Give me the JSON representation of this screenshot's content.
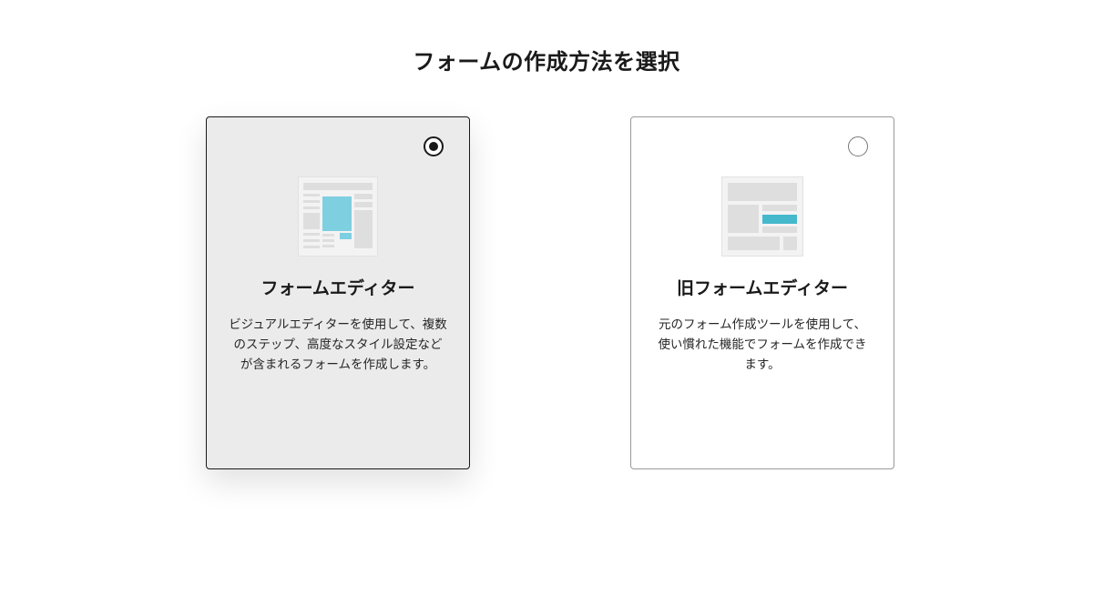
{
  "header": {
    "title": "フォームの作成方法を選択"
  },
  "options": [
    {
      "title": "フォームエディター",
      "description": "ビジュアルエディターを使用して、複数のステップ、高度なスタイル設定などが含まれるフォームを作成します。",
      "selected": true,
      "accent_color": "#7ecfe0"
    },
    {
      "title": "旧フォームエディター",
      "description": "元のフォーム作成ツールを使用して、使い慣れた機能でフォームを作成できます。",
      "selected": false,
      "accent_color": "#45b8cc"
    }
  ]
}
